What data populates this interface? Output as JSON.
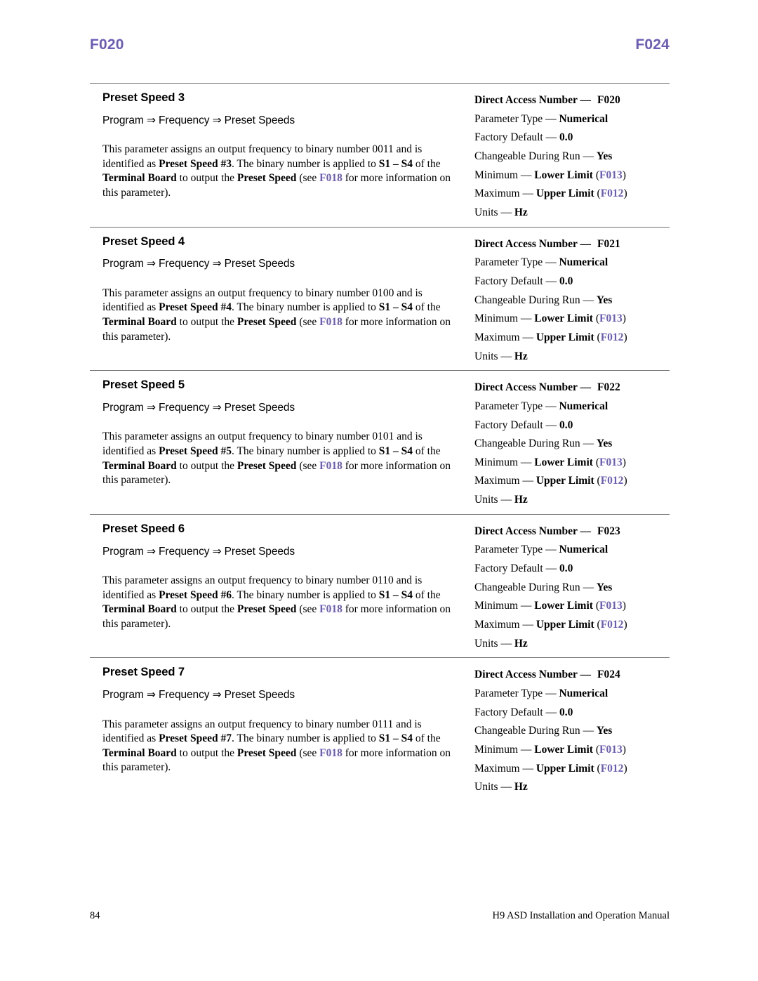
{
  "running_head": {
    "left": "F020",
    "right": "F024",
    "accent_color": "#6b5cb8"
  },
  "footer": {
    "page_number": "84",
    "manual_title": "H9 ASD Installation and Operation Manual"
  },
  "spec_labels": {
    "direct_access_number": "Direct Access Number",
    "parameter_type": "Parameter Type",
    "factory_default": "Factory Default",
    "changeable_during_run": "Changeable During Run",
    "minimum": "Minimum",
    "maximum": "Maximum",
    "units": "Units",
    "dash": "—"
  },
  "parameters": [
    {
      "title": "Preset Speed 3",
      "path": "Program ⇒ Frequency ⇒ Preset Speeds",
      "desc": {
        "t1": "This parameter assigns an output frequency to binary number 0011 and is identified as ",
        "b1": "Preset Speed #3",
        "t2": ". The binary number is applied to ",
        "b2": "S1 – S4",
        "t3": " of the ",
        "b3": "Terminal Board",
        "t4": " to output the ",
        "b4": "Preset Speed",
        "t5": " (see ",
        "ref": "F018",
        "t6": " for more information on this parameter)."
      },
      "spec": {
        "direct_access_number": "F020",
        "parameter_type": "Numerical",
        "factory_default": "0.0",
        "changeable_during_run": "Yes",
        "minimum_label": "Lower Limit",
        "minimum_ref": "F013",
        "maximum_label": "Upper Limit",
        "maximum_ref": "F012",
        "units": "Hz"
      }
    },
    {
      "title": "Preset Speed 4",
      "path": "Program ⇒ Frequency ⇒ Preset Speeds",
      "desc": {
        "t1": "This parameter assigns an output frequency to binary number 0100 and is identified as ",
        "b1": "Preset Speed #4",
        "t2": ". The binary number is applied to ",
        "b2": "S1 – S4",
        "t3": " of the ",
        "b3": "Terminal Board",
        "t4": " to output the ",
        "b4": "Preset Speed",
        "t5": " (see ",
        "ref": "F018",
        "t6": " for more information on this parameter)."
      },
      "spec": {
        "direct_access_number": "F021",
        "parameter_type": "Numerical",
        "factory_default": "0.0",
        "changeable_during_run": "Yes",
        "minimum_label": "Lower Limit",
        "minimum_ref": "F013",
        "maximum_label": "Upper Limit",
        "maximum_ref": "F012",
        "units": "Hz"
      }
    },
    {
      "title": "Preset Speed 5",
      "path": "Program ⇒ Frequency ⇒ Preset Speeds",
      "desc": {
        "t1": "This parameter assigns an output frequency to binary number 0101 and is identified as ",
        "b1": "Preset Speed #5",
        "t2": ". The binary number is applied to ",
        "b2": "S1 – S4",
        "t3": " of the ",
        "b3": "Terminal Board",
        "t4": " to output the ",
        "b4": "Preset Speed",
        "t5": " (see ",
        "ref": "F018",
        "t6": " for more information on this parameter)."
      },
      "spec": {
        "direct_access_number": "F022",
        "parameter_type": "Numerical",
        "factory_default": "0.0",
        "changeable_during_run": "Yes",
        "minimum_label": "Lower Limit",
        "minimum_ref": "F013",
        "maximum_label": "Upper Limit",
        "maximum_ref": "F012",
        "units": "Hz"
      }
    },
    {
      "title": "Preset Speed 6",
      "path": "Program ⇒ Frequency ⇒ Preset Speeds",
      "desc": {
        "t1": "This parameter assigns an output frequency to binary number 0110 and is identified as ",
        "b1": "Preset Speed #6",
        "t2": ". The binary number is applied to ",
        "b2": "S1 – S4",
        "t3": " of the ",
        "b3": "Terminal Board",
        "t4": " to output the ",
        "b4": "Preset Speed",
        "t5": " (see ",
        "ref": "F018",
        "t6": " for more information on this parameter)."
      },
      "spec": {
        "direct_access_number": "F023",
        "parameter_type": "Numerical",
        "factory_default": "0.0",
        "changeable_during_run": "Yes",
        "minimum_label": "Lower Limit",
        "minimum_ref": "F013",
        "maximum_label": "Upper Limit",
        "maximum_ref": "F012",
        "units": "Hz"
      }
    },
    {
      "title": "Preset Speed 7",
      "path": "Program ⇒ Frequency ⇒ Preset Speeds",
      "desc": {
        "t1": "This parameter assigns an output frequency to binary number 0111 and is identified as ",
        "b1": "Preset Speed #7",
        "t2": ". The binary number is applied to ",
        "b2": "S1 – S4",
        "t3": " of the ",
        "b3": "Terminal Board",
        "t4": " to output the ",
        "b4": "Preset Speed",
        "t5": " (see ",
        "ref": "F018",
        "t6": " for more information on this parameter)."
      },
      "spec": {
        "direct_access_number": "F024",
        "parameter_type": "Numerical",
        "factory_default": "0.0",
        "changeable_during_run": "Yes",
        "minimum_label": "Lower Limit",
        "minimum_ref": "F013",
        "maximum_label": "Upper Limit",
        "maximum_ref": "F012",
        "units": "Hz"
      }
    }
  ]
}
